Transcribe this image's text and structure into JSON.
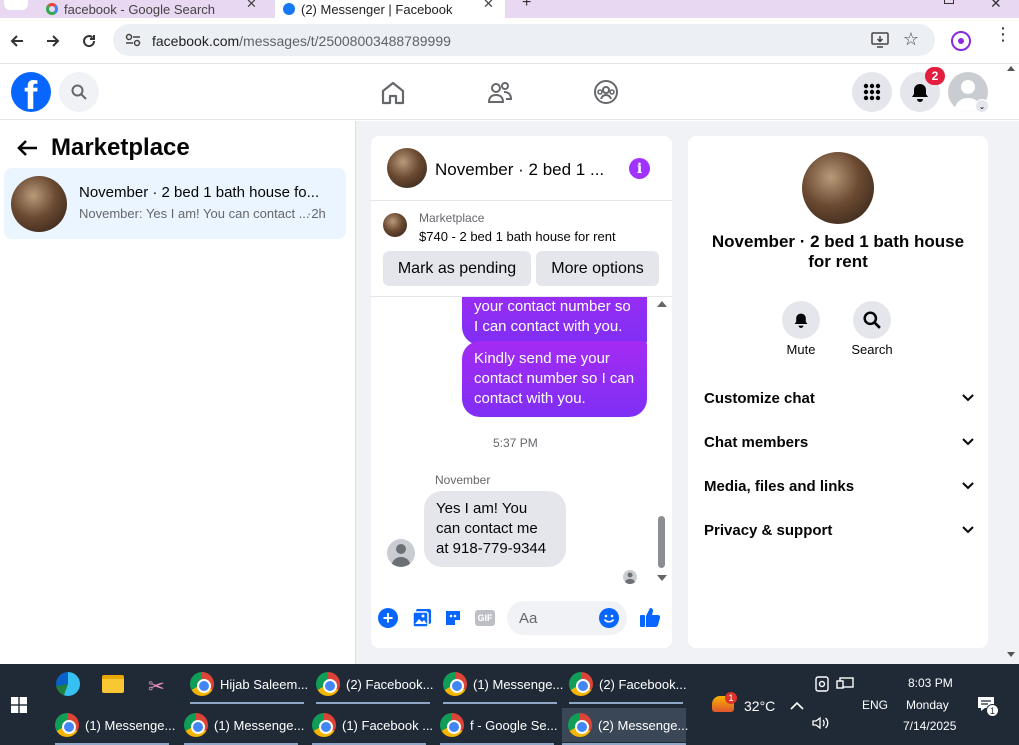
{
  "browser": {
    "tabs": [
      {
        "label": "facebook - Google Search"
      },
      {
        "label": "(2) Messenger | Facebook"
      }
    ],
    "url_host": "facebook.com",
    "url_path": "/messages/t/25008003488789999"
  },
  "fb": {
    "notification_count": "2"
  },
  "left": {
    "title": "Marketplace",
    "thread_title": "November · 2 bed 1 bath house fo...",
    "thread_preview": "November: Yes I am! You can contact ...",
    "thread_time": "·2h"
  },
  "chat": {
    "header_title": "November · 2 bed 1 ...",
    "listing_source": "Marketplace",
    "listing_desc": "$740 - 2 bed 1 bath house for rent",
    "mark_pending": "Mark as pending",
    "more_options": "More options",
    "msg_partial": "your contact number so I can contact with you.",
    "msg_full": "Kindly send me your contact number so I can contact with you.",
    "timestamp": "5:37 PM",
    "sender_name": "November",
    "reply": "Yes I am! You can contact me at 918-779-9344",
    "composer_placeholder": "Aa"
  },
  "info": {
    "title": "November · 2 bed 1 bath house for rent",
    "mute_label": "Mute",
    "search_label": "Search",
    "sections": [
      "Customize chat",
      "Chat members",
      "Media, files and links",
      "Privacy & support"
    ]
  },
  "taskbar": {
    "row1": [
      "Hijab Saleem...",
      "(2) Facebook...",
      "(1) Messenge...",
      "(2) Facebook..."
    ],
    "row2": [
      "(1) Messenge...",
      "(1) Messenge...",
      "(1) Facebook ...",
      "f - Google Se...",
      "(2) Messenge..."
    ],
    "weather_badge": "1",
    "temperature": "32°C",
    "lang": "ENG",
    "time": "8:03 PM",
    "day": "Monday",
    "date": "7/14/2025",
    "notif_badge": "1"
  }
}
